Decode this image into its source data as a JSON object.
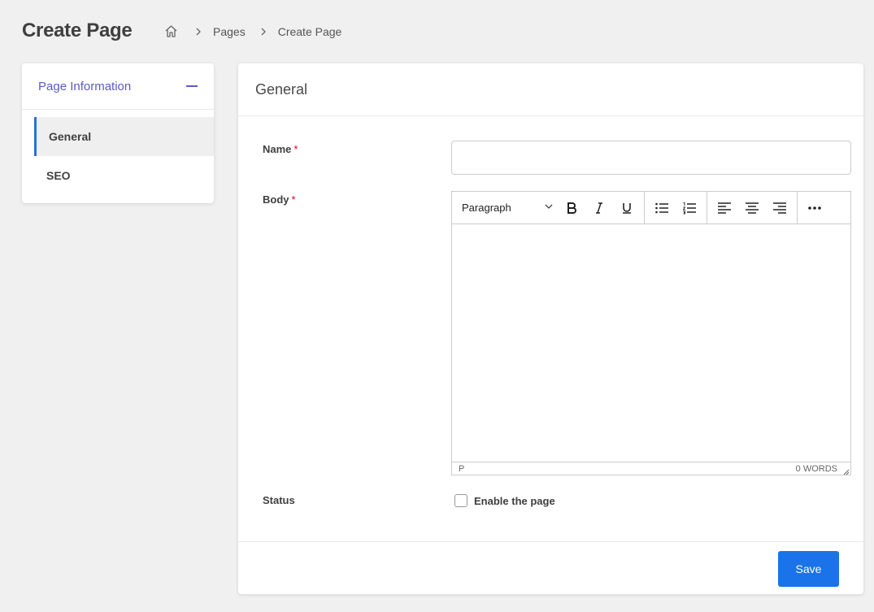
{
  "header": {
    "title": "Create Page",
    "breadcrumb": [
      "Pages",
      "Create Page"
    ]
  },
  "sidebar": {
    "title": "Page Information",
    "items": [
      {
        "label": "General",
        "active": true
      },
      {
        "label": "SEO",
        "active": false
      }
    ]
  },
  "form": {
    "section_title": "General",
    "name": {
      "label": "Name",
      "required_mark": "*",
      "value": ""
    },
    "body": {
      "label": "Body",
      "required_mark": "*",
      "format_selected": "Paragraph",
      "status_element": "P",
      "word_count": "0 WORDS"
    },
    "status": {
      "label": "Status",
      "checkbox_label": "Enable the page",
      "checked": false
    },
    "save_label": "Save"
  },
  "colors": {
    "accent": "#5b5bc4",
    "primary": "#1a73e8",
    "active_border": "#2b6fdc",
    "required": "#d0021b"
  },
  "icons": [
    "home-icon",
    "chevron-right-icon",
    "minus-icon",
    "chevron-down-icon",
    "bold-icon",
    "italic-icon",
    "underline-icon",
    "bullet-list-icon",
    "numbered-list-icon",
    "align-left-icon",
    "align-center-icon",
    "align-right-icon",
    "more-icon",
    "resize-handle-icon"
  ]
}
